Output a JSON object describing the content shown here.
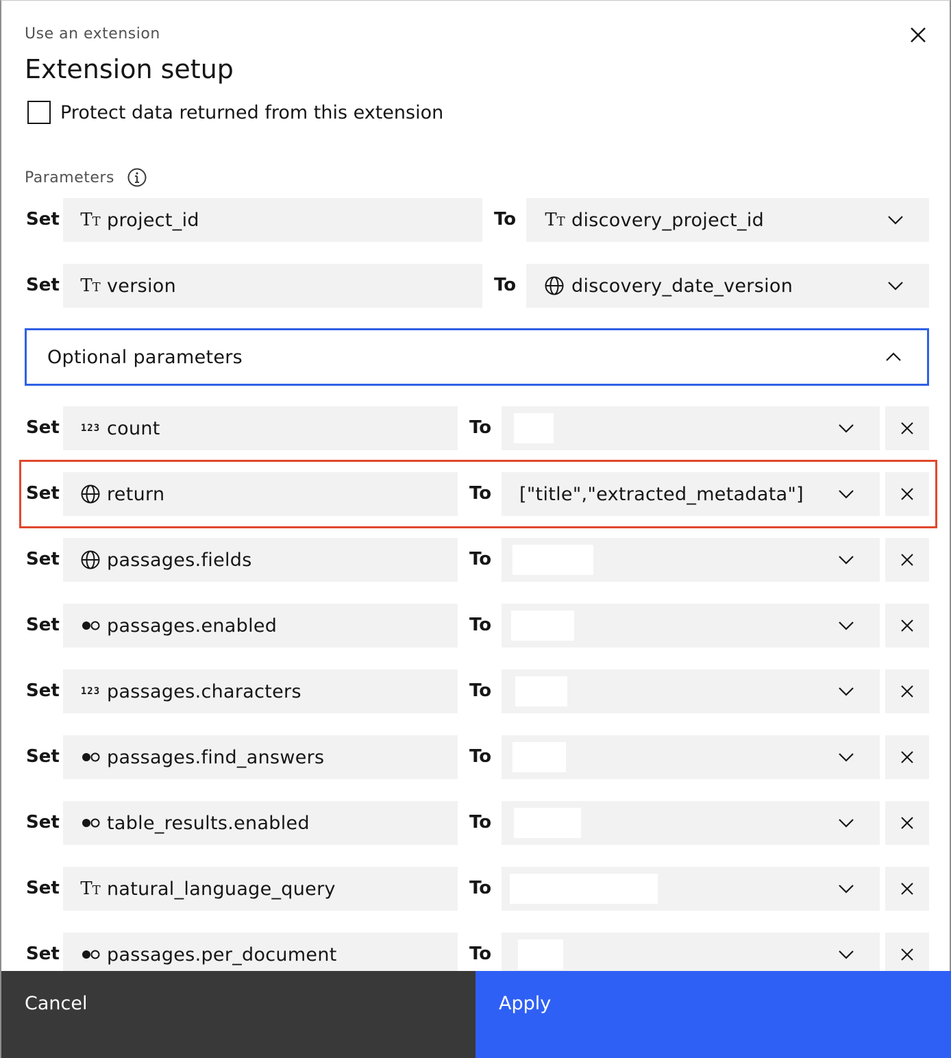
{
  "header": {
    "subtitle": "Use an extension",
    "title": "Extension setup",
    "close_icon": "close-icon"
  },
  "protect": {
    "label": "Protect data returned from this extension",
    "checked": false
  },
  "parameters": {
    "label": "Parameters",
    "info_icon": "information-icon",
    "rows": [
      {
        "set": "Set",
        "type_icon": "text-icon",
        "name": "project_id",
        "to": "To",
        "value_icon": "text-icon",
        "value": "discovery_project_id"
      },
      {
        "set": "Set",
        "type_icon": "text-icon",
        "name": "version",
        "to": "To",
        "value_icon": "globe-icon",
        "value": "discovery_date_version"
      }
    ]
  },
  "optional": {
    "label": "Optional parameters",
    "expanded": true,
    "rows": [
      {
        "set": "Set",
        "type_icon": "number-icon",
        "name": "count",
        "to": "To",
        "value": ""
      },
      {
        "set": "Set",
        "type_icon": "globe-icon",
        "name": "return",
        "to": "To",
        "value": "[\"title\",\"extracted_metadata\"]"
      },
      {
        "set": "Set",
        "type_icon": "globe-icon",
        "name": "passages.fields",
        "to": "To",
        "value": ""
      },
      {
        "set": "Set",
        "type_icon": "boolean-icon",
        "name": "passages.enabled",
        "to": "To",
        "value": ""
      },
      {
        "set": "Set",
        "type_icon": "number-icon",
        "name": "passages.characters",
        "to": "To",
        "value": ""
      },
      {
        "set": "Set",
        "type_icon": "boolean-icon",
        "name": "passages.find_answers",
        "to": "To",
        "value": ""
      },
      {
        "set": "Set",
        "type_icon": "boolean-icon",
        "name": "table_results.enabled",
        "to": "To",
        "value": ""
      },
      {
        "set": "Set",
        "type_icon": "text-icon",
        "name": "natural_language_query",
        "to": "To",
        "value": ""
      },
      {
        "set": "Set",
        "type_icon": "boolean-icon",
        "name": "passages.per_document",
        "to": "To",
        "value": ""
      }
    ]
  },
  "icons": {
    "text_symbol": "TT",
    "number_symbol": "123"
  },
  "footer": {
    "cancel_label": "Cancel",
    "apply_label": "Apply"
  },
  "colors": {
    "accent": "#2f60f5",
    "highlight": "#e0482c",
    "field_bg": "#f2f2f2",
    "cancel_bg": "#393939"
  }
}
